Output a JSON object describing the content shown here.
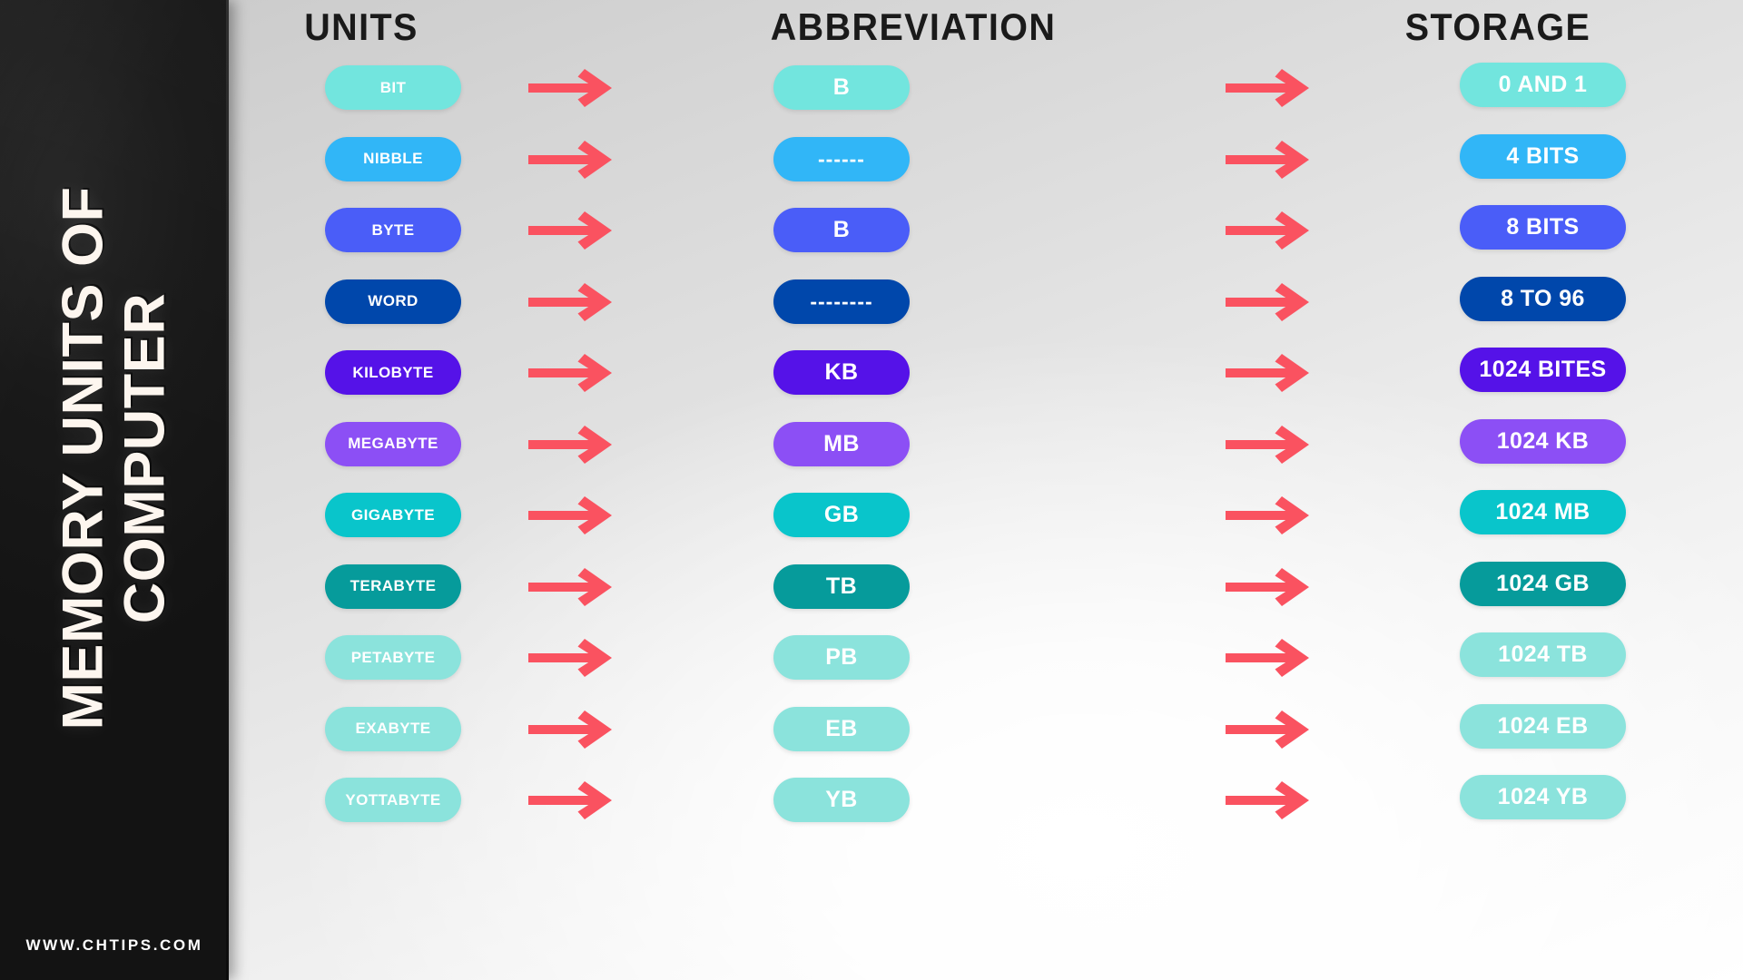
{
  "sidebar": {
    "title_line_1": "MEMORY UNITS OF",
    "title_line_2": "COMPUTER",
    "url": "WWW.CHTIPS.COM",
    "background_color": "#161616"
  },
  "headers": {
    "units": "UNITS",
    "abbreviation": "ABBREVIATION",
    "storage": "STORAGE",
    "color": "#1a1a1a"
  },
  "arrow": {
    "icon": "arrow-right-icon",
    "color": "#FA5260"
  },
  "rows": [
    {
      "unit": "BIT",
      "abbreviation": "B",
      "storage": "0 AND 1",
      "color": "#72E5DE"
    },
    {
      "unit": "NIBBLE",
      "abbreviation": "------",
      "storage": "4 BITS",
      "color": "#31B6F7"
    },
    {
      "unit": "BYTE",
      "abbreviation": "B",
      "storage": "8 BITS",
      "color": "#4A5DF8"
    },
    {
      "unit": "WORD",
      "abbreviation": "--------",
      "storage": "8 TO 96",
      "color": "#0047AB"
    },
    {
      "unit": "KILOBYTE",
      "abbreviation": "KB",
      "storage": "1024 BITES",
      "color": "#5512E8"
    },
    {
      "unit": "MEGABYTE",
      "abbreviation": "MB",
      "storage": "1024 KB",
      "color": "#8C4FF5"
    },
    {
      "unit": "GIGABYTE",
      "abbreviation": "GB",
      "storage": "1024 MB",
      "color": "#09C5CB"
    },
    {
      "unit": "TERABYTE",
      "abbreviation": "TB",
      "storage": "1024 GB",
      "color": "#069B9B"
    },
    {
      "unit": "PETABYTE",
      "abbreviation": "PB",
      "storage": "1024 TB",
      "color": "#8BE3DC"
    },
    {
      "unit": "EXABYTE",
      "abbreviation": "EB",
      "storage": "1024 EB",
      "color": "#8BE3DC"
    },
    {
      "unit": "YOTTABYTE",
      "abbreviation": "YB",
      "storage": "1024 YB",
      "color": "#8BE3DC"
    }
  ]
}
